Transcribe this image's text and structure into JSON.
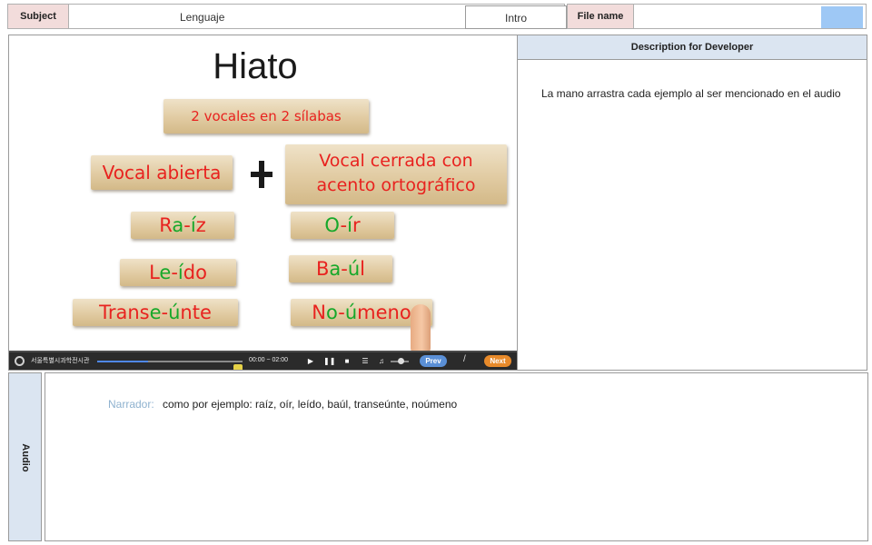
{
  "header": {
    "subject_label": "Subject",
    "subject_value": "Lenguaje",
    "section": "Intro",
    "file_label": "File name",
    "file_value": ""
  },
  "slide": {
    "title": "Hiato",
    "syllable_tag": "2 vocales  en 2 sílabas",
    "open_vowel": "Vocal  abierta",
    "closed_vowel_line1": "Vocal  cerrada con",
    "closed_vowel_line2": "acento ortográfico",
    "examples": [
      {
        "parts": [
          {
            "t": "R",
            "c": "r"
          },
          {
            "t": "a",
            "c": "g"
          },
          {
            "t": "-",
            "c": "r"
          },
          {
            "t": "í",
            "c": "g"
          },
          {
            "t": "z",
            "c": "r"
          }
        ]
      },
      {
        "parts": [
          {
            "t": "O",
            "c": "g"
          },
          {
            "t": "-",
            "c": "r"
          },
          {
            "t": "í",
            "c": "g"
          },
          {
            "t": "r",
            "c": "r"
          }
        ]
      },
      {
        "parts": [
          {
            "t": "L",
            "c": "r"
          },
          {
            "t": "e",
            "c": "g"
          },
          {
            "t": "-",
            "c": "r"
          },
          {
            "t": "í",
            "c": "g"
          },
          {
            "t": "do",
            "c": "r"
          }
        ]
      },
      {
        "parts": [
          {
            "t": "B",
            "c": "r"
          },
          {
            "t": "a",
            "c": "g"
          },
          {
            "t": "-",
            "c": "r"
          },
          {
            "t": "ú",
            "c": "g"
          },
          {
            "t": "l",
            "c": "r"
          }
        ]
      },
      {
        "parts": [
          {
            "t": "Trans",
            "c": "r"
          },
          {
            "t": "e",
            "c": "g"
          },
          {
            "t": "-",
            "c": "r"
          },
          {
            "t": "ú",
            "c": "g"
          },
          {
            "t": "nte",
            "c": "r"
          }
        ]
      },
      {
        "parts": [
          {
            "t": "N",
            "c": "r"
          },
          {
            "t": "o",
            "c": "g"
          },
          {
            "t": "-",
            "c": "r"
          },
          {
            "t": "ú",
            "c": "g"
          },
          {
            "t": "meno",
            "c": "r"
          }
        ]
      }
    ]
  },
  "player": {
    "org": "서울특별시과학전시관",
    "time": "00:00 ~ 02:00",
    "progress": 0.35,
    "prev_label": "Prev",
    "separator": "/",
    "next_label": "Next"
  },
  "description": {
    "heading": "Description for Developer",
    "text": "La mano arrastra cada ejemplo al ser mencionado en el audio"
  },
  "audio": {
    "tab_label": "Audio",
    "speaker": "Narrador:",
    "line": "como por ejemplo: raíz, oír, leído, baúl, transeúnte, noúmeno"
  },
  "colors": {
    "label_bg": "#f2dcdb",
    "panel_head_bg": "#dbe5f1",
    "word_red": "#e8221f",
    "word_green": "#16a82a",
    "prev_button": "#5a8fd6",
    "next_button": "#e88a2a"
  }
}
